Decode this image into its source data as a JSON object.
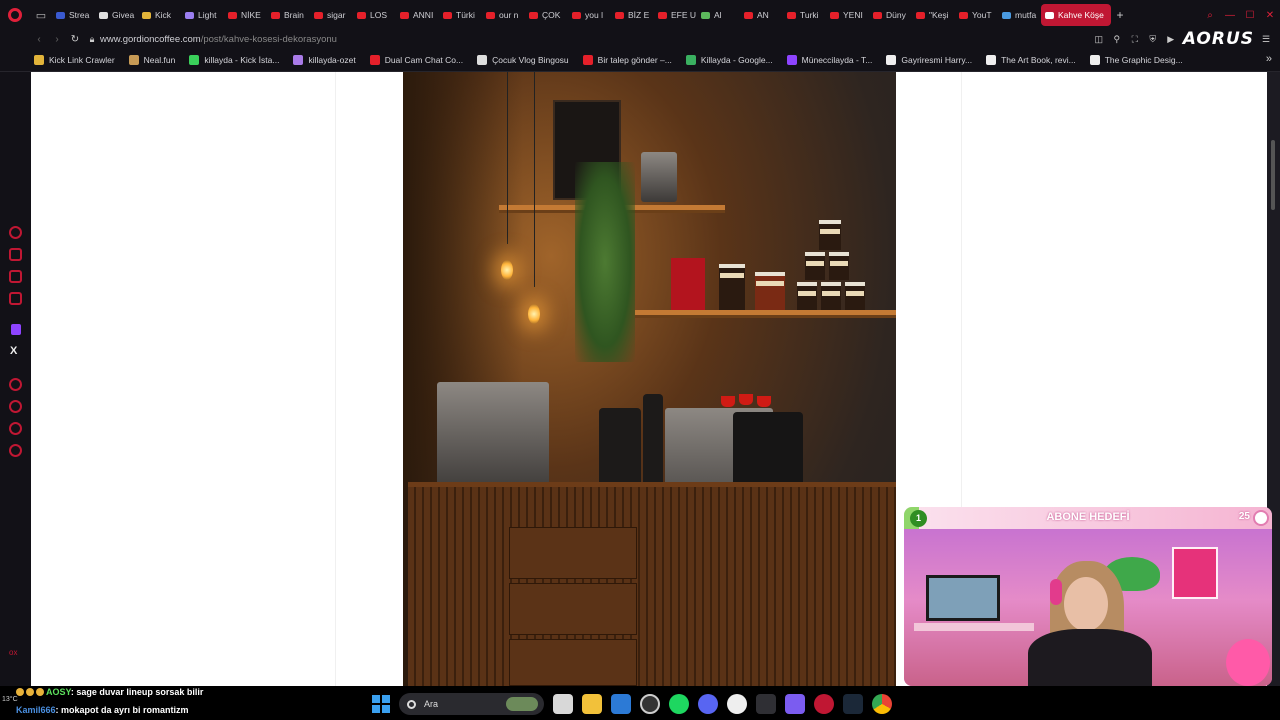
{
  "browser": {
    "tabs": [
      {
        "label": "Strea",
        "fav_color": "#3a5ad0"
      },
      {
        "label": "Givea",
        "fav_color": "#e0e0e0"
      },
      {
        "label": "Kick",
        "fav_color": "#e2b43a"
      },
      {
        "label": "Light",
        "fav_color": "#9b7ff0"
      },
      {
        "label": "NİKE",
        "fav_color": "#e5202a"
      },
      {
        "label": "Brain",
        "fav_color": "#e5202a"
      },
      {
        "label": "sigar",
        "fav_color": "#e5202a"
      },
      {
        "label": "LOS",
        "fav_color": "#e5202a"
      },
      {
        "label": "ANNI",
        "fav_color": "#e5202a"
      },
      {
        "label": "Türki",
        "fav_color": "#e5202a"
      },
      {
        "label": "our n",
        "fav_color": "#e5202a"
      },
      {
        "label": "ÇOK",
        "fav_color": "#e5202a"
      },
      {
        "label": "you l",
        "fav_color": "#e5202a"
      },
      {
        "label": "BİZ E",
        "fav_color": "#e5202a"
      },
      {
        "label": "EFE U",
        "fav_color": "#e5202a"
      },
      {
        "label": "Al",
        "fav_color": "#5cb85c"
      },
      {
        "label": "AN",
        "fav_color": "#e5202a"
      },
      {
        "label": "Turki",
        "fav_color": "#e5202a"
      },
      {
        "label": "YENI",
        "fav_color": "#e5202a"
      },
      {
        "label": "Düny",
        "fav_color": "#e5202a"
      },
      {
        "label": "\"Keşi",
        "fav_color": "#e5202a"
      },
      {
        "label": "YouT",
        "fav_color": "#e5202a"
      },
      {
        "label": "mutfa",
        "fav_color": "#4a9ae0"
      },
      {
        "label": "Kahve Köşe",
        "fav_color": "#ffffff",
        "active": true
      }
    ],
    "url_host": "www.gordioncoffee.com",
    "url_path": "/post/kahve-kosesi-dekorasyonu",
    "brand": "AORUS"
  },
  "bookmarks": [
    {
      "label": "Kick Link Crawler",
      "fav_color": "#e2b43a"
    },
    {
      "label": "Neal.fun",
      "fav_color": "#c79a55"
    },
    {
      "label": "killayda - Kick İsta...",
      "fav_color": "#3ad05a"
    },
    {
      "label": "killayda-ozet",
      "fav_color": "#a97be8"
    },
    {
      "label": "Dual Cam Chat Co...",
      "fav_color": "#e5202a"
    },
    {
      "label": "Çocuk Vlog Bingosu",
      "fav_color": "#dddddd"
    },
    {
      "label": "Bir talep gönder –...",
      "fav_color": "#e5202a"
    },
    {
      "label": "Killayda - Google...",
      "fav_color": "#3ab060"
    },
    {
      "label": "Müneccilayda - T...",
      "fav_color": "#8e44ff"
    },
    {
      "label": "Gayriresmi Harry...",
      "fav_color": "#eeeeee"
    },
    {
      "label": "The Art Book, revi...",
      "fav_color": "#eeeeee"
    },
    {
      "label": "The Graphic Desig...",
      "fav_color": "#eeeeee"
    }
  ],
  "sidebar": {
    "bottom_text": "ox",
    "x_icon": "X"
  },
  "stream_overlay": {
    "goal_label": "ABONE HEDEFİ",
    "goal_current": "1",
    "goal_target": "25",
    "goal_progress": 0.04
  },
  "chat": {
    "lines": [
      {
        "user": "AOSY",
        "message": ": sage duvar lineup sorsak bilir"
      },
      {
        "user": "Kamil666",
        "message": ": mokapot da ayrı bi romantizm"
      }
    ]
  },
  "taskbar": {
    "search_placeholder": "Ara",
    "weather_temp": "13°C"
  },
  "colors": {
    "accent": "#c01733",
    "page_bg": "#ffffff",
    "chrome_bg": "#121117"
  }
}
